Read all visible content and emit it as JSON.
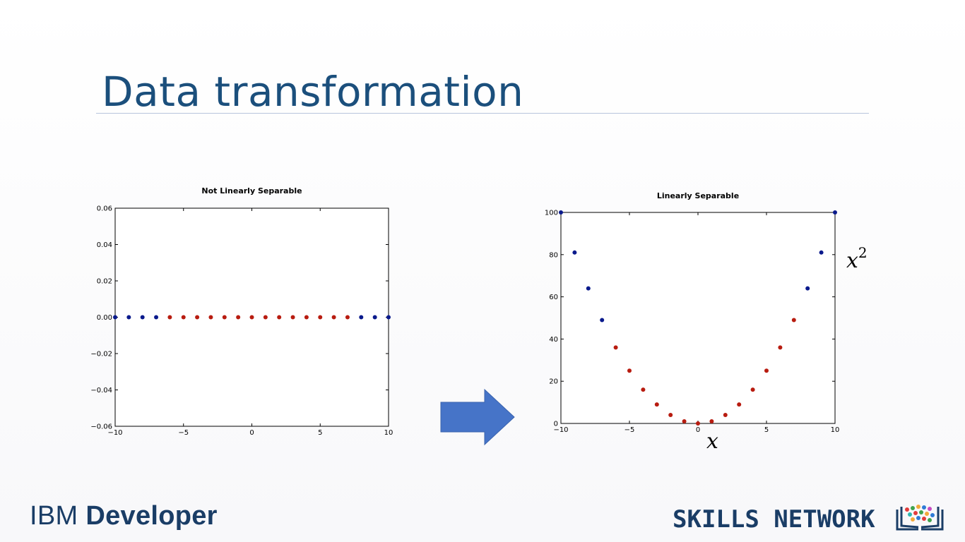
{
  "slide": {
    "title": "Data transformation"
  },
  "left_axis_x_label": "",
  "right_x_label": "x",
  "right_y_label_base": "x",
  "right_y_label_exp": "2",
  "footer": {
    "ibm_word1": "IBM",
    "ibm_word2": "Developer",
    "skills": "SKILLS NETWORK"
  },
  "colors": {
    "title": "#1b4f7c",
    "blue_class": "#0a1a8c",
    "red_class": "#b81c10",
    "arrow": "#4674c8"
  },
  "icons": {
    "arrow": "right-arrow-icon",
    "skills_logo": "open-book-icon"
  },
  "chart_data": [
    {
      "type": "scatter",
      "title": "Not Linearly Separable",
      "xlim": [
        -10,
        10
      ],
      "ylim": [
        -0.06,
        0.06
      ],
      "xticks": [
        "−10",
        "−5",
        "0",
        "5",
        "10"
      ],
      "xtick_values": [
        -10,
        -5,
        0,
        5,
        10
      ],
      "yticks": [
        "0.06",
        "0.04",
        "0.02",
        "0.00",
        "−0.02",
        "−0.04",
        "−0.06"
      ],
      "ytick_values": [
        0.06,
        0.04,
        0.02,
        0.0,
        -0.02,
        -0.04,
        -0.06
      ],
      "grid": false,
      "series": [
        {
          "color": "#0a1a8c",
          "x": [
            -10,
            -9,
            -8,
            -7,
            8,
            9,
            10
          ],
          "y": [
            0,
            0,
            0,
            0,
            0,
            0,
            0
          ]
        },
        {
          "color": "#b81c10",
          "x": [
            -6,
            -5,
            -4,
            -3,
            -2,
            -1,
            0,
            1,
            2,
            3,
            4,
            5,
            6,
            7
          ],
          "y": [
            0,
            0,
            0,
            0,
            0,
            0,
            0,
            0,
            0,
            0,
            0,
            0,
            0,
            0
          ]
        }
      ]
    },
    {
      "type": "scatter",
      "title": "Linearly Separable",
      "xlim": [
        -10,
        10
      ],
      "ylim": [
        0,
        100
      ],
      "xticks": [
        "−10",
        "−5",
        "0",
        "5",
        "10"
      ],
      "xtick_values": [
        -10,
        -5,
        0,
        5,
        10
      ],
      "yticks": [
        "100",
        "80",
        "60",
        "40",
        "20",
        "0"
      ],
      "ytick_values": [
        100,
        80,
        60,
        40,
        20,
        0
      ],
      "grid": false,
      "series": [
        {
          "color": "#0a1a8c",
          "x": [
            -10,
            -9,
            -8,
            -7,
            8,
            9,
            10
          ],
          "y": [
            100,
            81,
            64,
            49,
            64,
            81,
            100
          ]
        },
        {
          "color": "#b81c10",
          "x": [
            -6,
            -5,
            -4,
            -3,
            -2,
            -1,
            0,
            1,
            2,
            3,
            4,
            5,
            6,
            7
          ],
          "y": [
            36,
            25,
            16,
            9,
            4,
            1,
            0,
            1,
            4,
            9,
            16,
            25,
            36,
            49
          ]
        }
      ]
    }
  ]
}
